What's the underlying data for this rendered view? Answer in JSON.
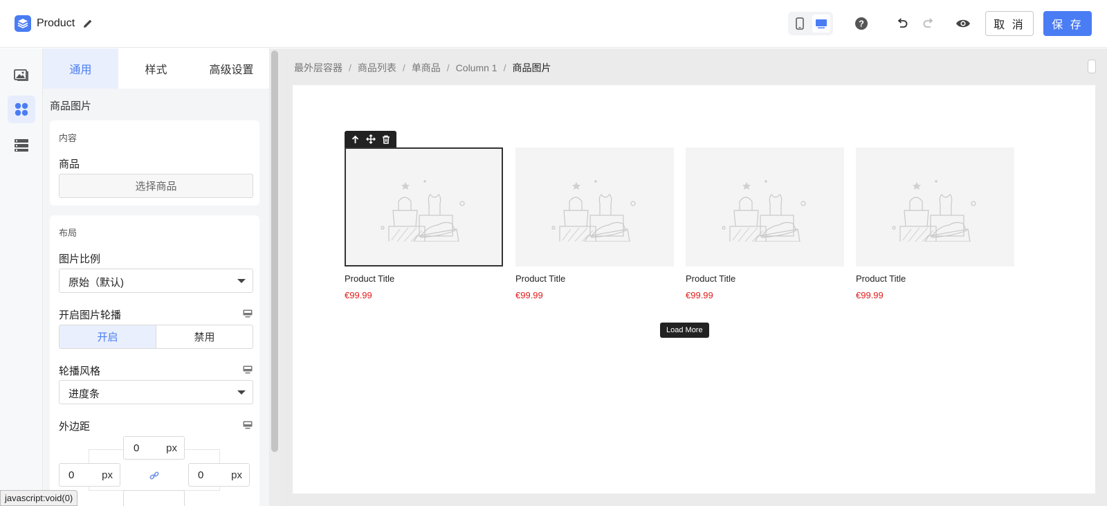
{
  "header": {
    "app_title": "Product",
    "cancel_label": "取 消",
    "save_label": "保 存",
    "accent_color": "#4a7cf3"
  },
  "rail": {
    "items": [
      {
        "icon": "image-gallery-icon"
      },
      {
        "icon": "components-icon",
        "active": true
      },
      {
        "icon": "layers-list-icon"
      }
    ]
  },
  "panel": {
    "tabs": [
      {
        "label": "通用",
        "active": true
      },
      {
        "label": "样式"
      },
      {
        "label": "高级设置"
      }
    ],
    "section_title": "商品图片",
    "content_card": {
      "label": "内容",
      "product_label": "商品",
      "select_button": "选择商品"
    },
    "layout_card": {
      "label": "布局",
      "ratio_label": "图片比例",
      "ratio_value": "原始（默认)",
      "carousel_label": "开启图片轮播",
      "carousel_on": "开启",
      "carousel_off": "禁用",
      "carousel_style_label": "轮播风格",
      "carousel_style_value": "进度条",
      "margin_label": "外边距",
      "margin_top": "0",
      "margin_left": "0",
      "margin_right": "0",
      "unit": "px"
    }
  },
  "breadcrumb": [
    "最外层容器",
    "商品列表",
    "单商品",
    "Column 1",
    "商品图片"
  ],
  "products": [
    {
      "title": "Product Title",
      "price": "€99.99",
      "selected": true
    },
    {
      "title": "Product Title",
      "price": "€99.99"
    },
    {
      "title": "Product Title",
      "price": "€99.99"
    },
    {
      "title": "Product Title",
      "price": "€99.99"
    }
  ],
  "load_more_label": "Load More",
  "status_tip": "javascript:void(0)"
}
